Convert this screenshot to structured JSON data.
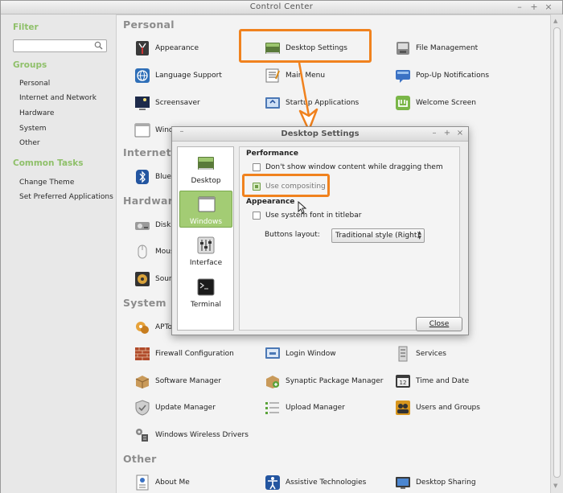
{
  "window": {
    "title": "Control Center",
    "controls": [
      "–",
      "+",
      "×"
    ]
  },
  "sidebar": {
    "filter_heading": "Filter",
    "filter_placeholder": "",
    "groups_heading": "Groups",
    "groups": [
      "Personal",
      "Internet and Network",
      "Hardware",
      "System",
      "Other"
    ],
    "tasks_heading": "Common Tasks",
    "tasks": [
      "Change Theme",
      "Set Preferred Applications"
    ]
  },
  "sections": {
    "personal": {
      "title": "Personal",
      "items": [
        {
          "label": "Appearance",
          "icon": "appearance-icon"
        },
        {
          "label": "Desktop Settings",
          "icon": "desktop-settings-icon"
        },
        {
          "label": "File Management",
          "icon": "file-management-icon"
        },
        {
          "label": "Language Support",
          "icon": "language-support-icon"
        },
        {
          "label": "Main Menu",
          "icon": "main-menu-icon"
        },
        {
          "label": "Pop-Up Notifications",
          "icon": "popup-notifications-icon"
        },
        {
          "label": "Screensaver",
          "icon": "screensaver-icon"
        },
        {
          "label": "Startup Applications",
          "icon": "startup-applications-icon"
        },
        {
          "label": "Welcome Screen",
          "icon": "welcome-screen-icon"
        },
        {
          "label": "Wind",
          "icon": "windows-icon"
        }
      ]
    },
    "internet": {
      "title": "Internet a",
      "items": [
        {
          "label": "Bluet",
          "icon": "bluetooth-icon"
        }
      ]
    },
    "hardware": {
      "title": "Hardware",
      "items": [
        {
          "label": "Disks",
          "icon": "disks-icon"
        },
        {
          "label": "Mous",
          "icon": "mouse-icon"
        },
        {
          "label": "Soun",
          "icon": "sound-icon"
        }
      ]
    },
    "system": {
      "title": "System",
      "items": [
        {
          "label": "APTon",
          "icon": "apton-icon"
        },
        {
          "label": "Firewall Configuration",
          "icon": "firewall-icon"
        },
        {
          "label": "Login Window",
          "icon": "login-window-icon"
        },
        {
          "label": "Services",
          "icon": "services-icon"
        },
        {
          "label": "Software Manager",
          "icon": "software-manager-icon"
        },
        {
          "label": "Synaptic Package Manager",
          "icon": "synaptic-icon"
        },
        {
          "label": "Time and Date",
          "icon": "time-date-icon"
        },
        {
          "label": "Update Manager",
          "icon": "update-manager-icon"
        },
        {
          "label": "Upload Manager",
          "icon": "upload-manager-icon"
        },
        {
          "label": "Users and Groups",
          "icon": "users-groups-icon"
        },
        {
          "label": "Windows Wireless Drivers",
          "icon": "wireless-drivers-icon"
        }
      ]
    },
    "other": {
      "title": "Other",
      "items": [
        {
          "label": "About Me",
          "icon": "about-me-icon"
        },
        {
          "label": "Assistive Technologies",
          "icon": "assistive-technologies-icon"
        },
        {
          "label": "Desktop Sharing",
          "icon": "desktop-sharing-icon"
        }
      ]
    }
  },
  "dialog": {
    "title": "Desktop Settings",
    "controls": [
      "–",
      "+",
      "×"
    ],
    "nav": [
      {
        "label": "Desktop",
        "icon": "desktop-icon",
        "active": false
      },
      {
        "label": "Windows",
        "icon": "windows-icon",
        "active": true
      },
      {
        "label": "Interface",
        "icon": "interface-icon",
        "active": false
      },
      {
        "label": "Terminal",
        "icon": "terminal-icon",
        "active": false
      }
    ],
    "performance_heading": "Performance",
    "dont_show_label": "Don't show window content while dragging them",
    "compositing_label": "Use compositing",
    "appearance_heading": "Appearance",
    "system_font_label": "Use system font in titlebar",
    "buttons_layout_label": "Buttons layout:",
    "buttons_layout_value": "Traditional style (Right)",
    "close_label": "Close"
  },
  "colors": {
    "accent_green": "#8fc06a",
    "callout_orange": "#f0821e",
    "active_nav": "#a3cc74"
  }
}
